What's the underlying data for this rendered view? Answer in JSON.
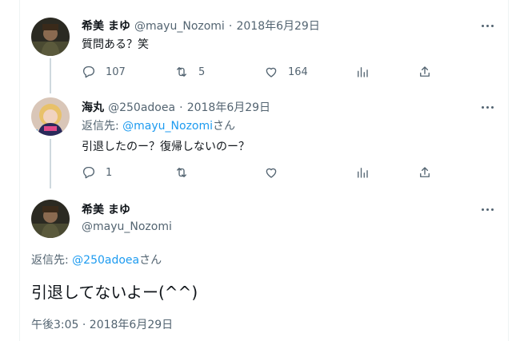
{
  "tweet1": {
    "display_name": "希美 まゆ",
    "handle": "@mayu_Nozomi",
    "separator": "·",
    "date": "2018年6月29日",
    "text": "質問ある？笑",
    "replies": "107",
    "retweets": "5",
    "likes": "164"
  },
  "tweet2": {
    "display_name": "海丸",
    "handle": "@250adoea",
    "separator": "·",
    "date": "2018年6月29日",
    "reply_prefix": "返信先: ",
    "reply_to": "@mayu_Nozomi",
    "reply_suffix": "さん",
    "text": "引退したのー？復帰しないのー？",
    "replies": "1",
    "retweets": "",
    "likes": ""
  },
  "main_tweet": {
    "display_name": "希美 まゆ",
    "handle": "@mayu_Nozomi",
    "reply_prefix": "返信先: ",
    "reply_to": "@250adoea",
    "reply_suffix": "さん",
    "text": "引退してないよー(^^)",
    "timestamp": "午後3:05 · 2018年6月29日"
  },
  "icons": [
    "more-icon",
    "reply-icon",
    "retweet-icon",
    "like-icon",
    "analytics-icon",
    "share-icon"
  ],
  "colors": {
    "link": "#1d9bf0",
    "secondary": "#536471",
    "primary": "#0f1419",
    "line": "#cfd9de"
  }
}
